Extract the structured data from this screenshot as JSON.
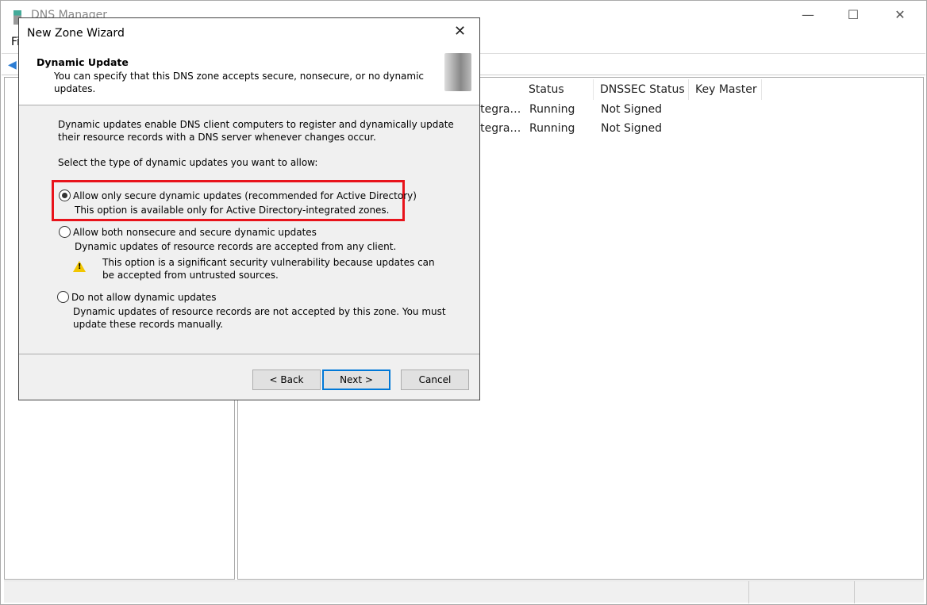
{
  "main_window": {
    "title": "DNS Manager",
    "menu_first": "File",
    "window_controls": {
      "minimize": "—",
      "maximize": "☐",
      "close": "✕"
    }
  },
  "list": {
    "columns": [
      "Status",
      "DNSSEC Status",
      "Key Master"
    ],
    "rows": [
      {
        "type": "Active Directory-Integra…",
        "status": "Running",
        "dnssec": "Not Signed"
      },
      {
        "type": "Active Directory-Integra…",
        "status": "Running",
        "dnssec": "Not Signed"
      }
    ]
  },
  "dialog": {
    "title": "New Zone Wizard",
    "close": "✕",
    "header_title": "Dynamic Update",
    "header_subtitle": "You can specify that this DNS zone accepts secure, nonsecure, or no dynamic updates.",
    "intro": "Dynamic updates enable DNS client computers to register and dynamically update their resource records with a DNS server whenever changes occur.",
    "prompt": "Select the type of dynamic updates you want to allow:",
    "options": [
      {
        "label": "Allow only secure dynamic updates (recommended for Active Directory)",
        "desc": "This option is available only for Active Directory-integrated zones.",
        "selected": true
      },
      {
        "label": "Allow both nonsecure and secure dynamic updates",
        "desc": "Dynamic updates of resource records are accepted from any client.",
        "warning": "This option is a significant security vulnerability because updates can be accepted from untrusted sources.",
        "selected": false
      },
      {
        "label": "Do not allow dynamic updates",
        "desc": "Dynamic updates of resource records are not accepted by this zone. You must update these records manually.",
        "selected": false
      }
    ],
    "buttons": {
      "back": "< Back",
      "next": "Next >",
      "cancel": "Cancel"
    },
    "highlight_color": "#e8131b"
  }
}
